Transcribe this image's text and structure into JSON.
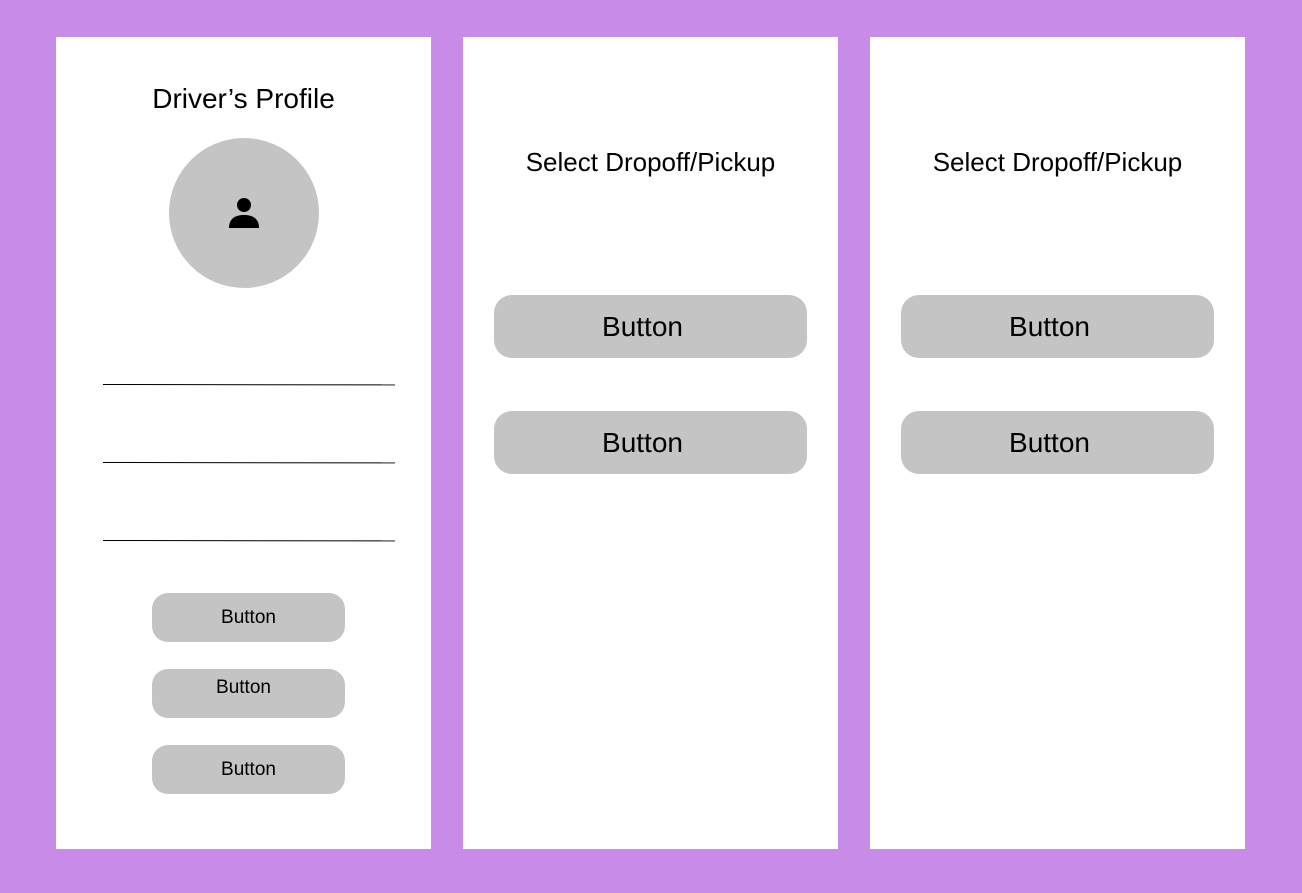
{
  "profile_screen": {
    "title": "Driver’s Profile",
    "avatar_icon": "person-icon",
    "buttons": [
      {
        "label": "Button"
      },
      {
        "label": "Button"
      },
      {
        "label": "Button"
      }
    ]
  },
  "select_screens": [
    {
      "title": "Select Dropoff/Pickup",
      "buttons": [
        {
          "label": "Button"
        },
        {
          "label": "Button"
        }
      ]
    },
    {
      "title": "Select Dropoff/Pickup",
      "buttons": [
        {
          "label": "Button"
        },
        {
          "label": "Button"
        }
      ]
    }
  ],
  "colors": {
    "background": "#c98be8",
    "panel": "#ffffff",
    "button_fill": "#c4c4c4",
    "avatar_fill": "#c4c4c4"
  }
}
